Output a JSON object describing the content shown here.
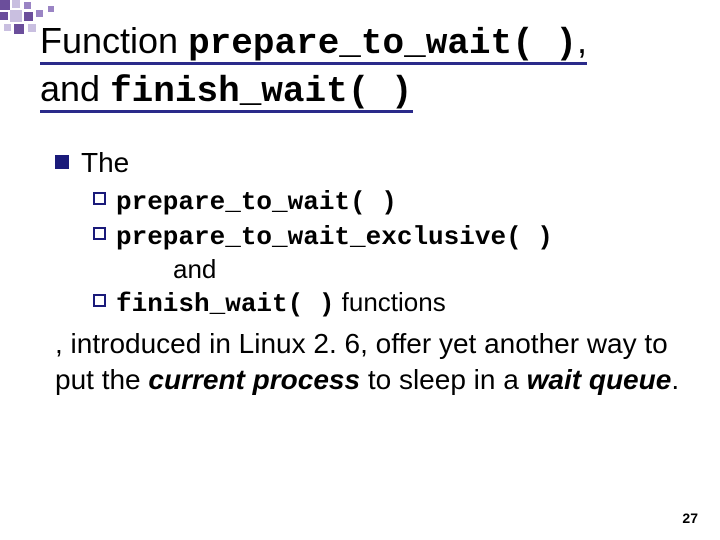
{
  "title": {
    "prefix": "Function ",
    "code1": "prepare_to_wait( )",
    "comma": ", ",
    "and": "and ",
    "code2": "finish_wait( )"
  },
  "body": {
    "the": "The",
    "items": [
      {
        "code": "prepare_to_wait( )",
        "tail": ""
      },
      {
        "code": "prepare_to_wait_exclusive( )",
        "tail": ""
      },
      {
        "code": "finish_wait( )",
        "tail": " functions"
      }
    ],
    "and_line": "and",
    "para_before": ", introduced in Linux 2. 6, offer yet another way to put the ",
    "para_em1": "current process",
    "para_mid": " to sleep in a ",
    "para_em2": "wait queue",
    "para_after": "."
  },
  "page": "27"
}
